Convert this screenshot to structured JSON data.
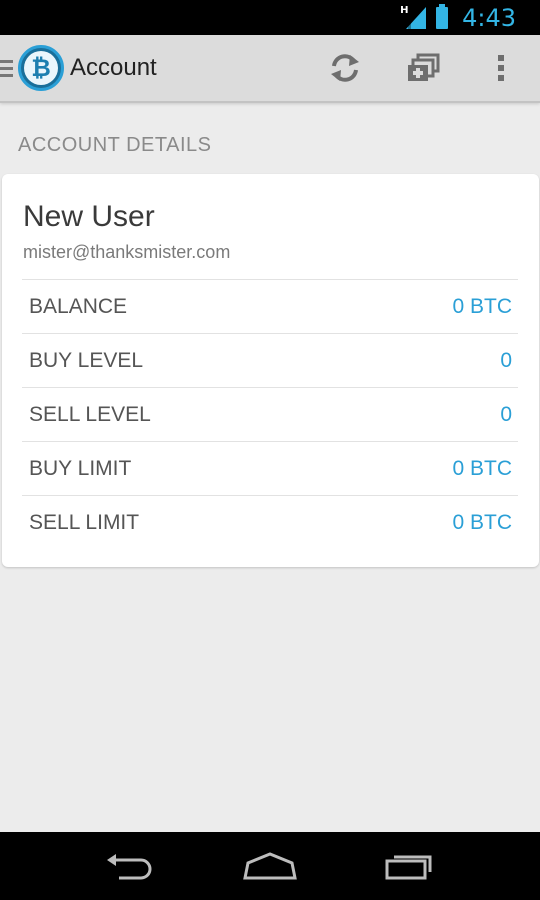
{
  "status_bar": {
    "network_type": "H",
    "time": "4:43"
  },
  "action_bar": {
    "title": "Account",
    "logo_symbol": "₿",
    "actions": [
      {
        "icon": "refresh-icon"
      },
      {
        "icon": "add-account-icon"
      },
      {
        "icon": "overflow-menu-icon"
      }
    ]
  },
  "section": {
    "header": "ACCOUNT DETAILS"
  },
  "account": {
    "name": "New User",
    "email": "mister@thanksmister.com",
    "details": [
      {
        "label": "BALANCE",
        "value": "0 BTC"
      },
      {
        "label": "BUY LEVEL",
        "value": "0"
      },
      {
        "label": "SELL LEVEL",
        "value": "0"
      },
      {
        "label": "BUY LIMIT",
        "value": "0 BTC"
      },
      {
        "label": "SELL LIMIT",
        "value": "0 BTC"
      }
    ]
  },
  "nav_bar": {
    "buttons": [
      "back-icon",
      "home-icon",
      "recent-apps-icon"
    ]
  },
  "colors": {
    "accent": "#33b5e5",
    "value_blue": "#2a9fd6",
    "background": "#ececec"
  }
}
